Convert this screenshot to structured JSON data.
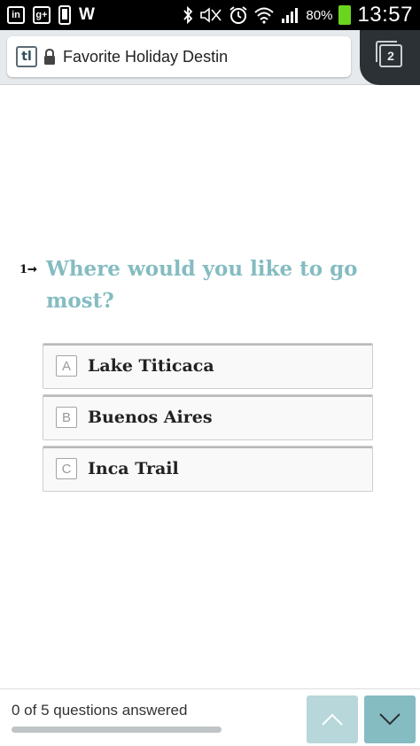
{
  "status_bar": {
    "icons": [
      "linkedin-icon",
      "google-plus-icon",
      "phone-icon",
      "w-icon",
      "bluetooth-icon",
      "mute-icon",
      "alarm-icon",
      "wifi-icon",
      "signal-icon",
      "battery-icon"
    ],
    "linkedin_text": "in",
    "gplus_text": "g+",
    "w_text": "W",
    "battery_percent": "80%",
    "time": "13:57"
  },
  "browser": {
    "site_icon_text": "tl",
    "page_title": "Favorite Holiday Destin",
    "tab_count": "2"
  },
  "question": {
    "number": "1",
    "text": "Where would you like to go most?",
    "choices": [
      {
        "key": "A",
        "label": "Lake Titicaca"
      },
      {
        "key": "B",
        "label": "Buenos Aires"
      },
      {
        "key": "C",
        "label": "Inca Trail"
      }
    ]
  },
  "footer": {
    "progress_text": "0 of 5 questions answered",
    "answered": 0,
    "total": 5
  },
  "colors": {
    "accent": "#84bcc1",
    "accent_light": "#b7d7da",
    "battery": "#6bd41f"
  }
}
